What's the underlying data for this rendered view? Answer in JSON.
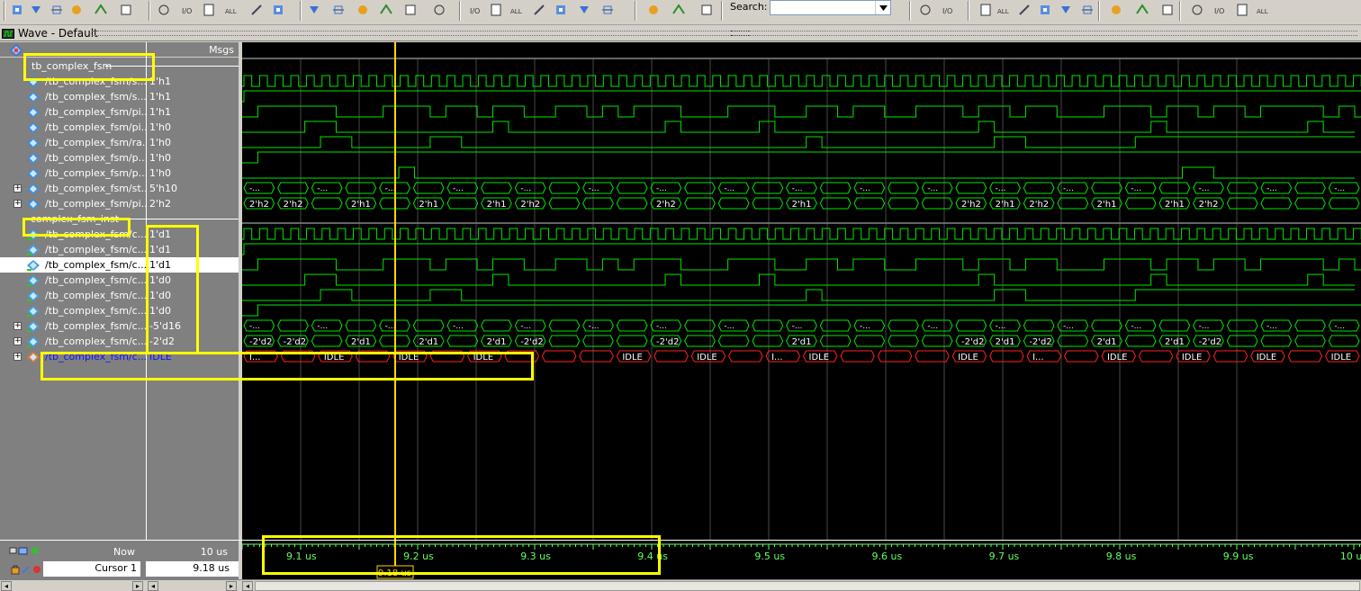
{
  "window": {
    "title": "Wave - Default"
  },
  "toolbar": {
    "search_label": "Search:",
    "search_value": "",
    "icons": [
      "add-wave-icon",
      "add-wave-dropdown-icon",
      "insert-divider-icon",
      "insert-breakpoint-icon",
      "dataflow-icon",
      "list-icon",
      "wildcard-icon",
      "log-icon",
      "all-icon",
      "write-icon",
      "select-mode-icon",
      "zoom-mode-icon",
      "pan-mode-icon",
      "edit-mode-icon",
      "stretch-edge-icon",
      "probe-icon",
      "find-previous-edge-icon",
      "find-next-edge-icon",
      "find-previous-fall-icon",
      "find-next-fall-icon",
      "find-previous-rise-icon",
      "find-next-rise-icon",
      "step-into-icon",
      "step-over-icon",
      "step-out-icon",
      "search-icon",
      "find-next-icon",
      "find-previous-icon",
      "zoom-in-icon",
      "zoom-out-icon",
      "zoom-full-icon",
      "zoom-cursor-icon",
      "zoom-range-icon",
      "insert-cursor-icon",
      "wave-format-icon",
      "bar-format-icon",
      "box-format-icon",
      "leaf-icon",
      "literal-icon",
      "event-icon"
    ]
  },
  "pane_header": {
    "msgs": "Msgs"
  },
  "groups": [
    {
      "label": "tb_complex_fsm"
    },
    {
      "label": "complex_fsm_inst"
    }
  ],
  "signals": [
    {
      "name": "/tb_complex_fsm/s...",
      "value": "1'h1",
      "kind": "in",
      "bus": false,
      "wave": "clk"
    },
    {
      "name": "/tb_complex_fsm/s...",
      "value": "1'h1",
      "kind": "in",
      "bus": false,
      "wave": "high"
    },
    {
      "name": "/tb_complex_fsm/pi...",
      "value": "1'h1",
      "kind": "in",
      "bus": false,
      "wave": "w3"
    },
    {
      "name": "/tb_complex_fsm/pi...",
      "value": "1'h0",
      "kind": "in",
      "bus": false,
      "wave": "w4"
    },
    {
      "name": "/tb_complex_fsm/ra...",
      "value": "1'h0",
      "kind": "in",
      "bus": false,
      "wave": "w5"
    },
    {
      "name": "/tb_complex_fsm/p...",
      "value": "1'h0",
      "kind": "in",
      "bus": false,
      "wave": "w6"
    },
    {
      "name": "/tb_complex_fsm/p...",
      "value": "1'h0",
      "kind": "in",
      "bus": false,
      "wave": "w7"
    },
    {
      "name": "/tb_complex_fsm/st...",
      "value": "5'h10",
      "kind": "in",
      "bus": true,
      "wave": "bus"
    },
    {
      "name": "/tb_complex_fsm/pi...",
      "value": "2'h2",
      "kind": "in",
      "bus": true,
      "wave": "bus2"
    },
    {
      "name": "/tb_complex_fsm/c...",
      "value": "1'd1",
      "kind": "port",
      "bus": false,
      "wave": "clk"
    },
    {
      "name": "/tb_complex_fsm/c...",
      "value": "1'd1",
      "kind": "port",
      "bus": false,
      "wave": "high"
    },
    {
      "name": "/tb_complex_fsm/c...",
      "value": "1'd1",
      "kind": "port",
      "bus": false,
      "wave": "w3",
      "selected": true
    },
    {
      "name": "/tb_complex_fsm/c...",
      "value": "1'd0",
      "kind": "port",
      "bus": false,
      "wave": "w4"
    },
    {
      "name": "/tb_complex_fsm/c...",
      "value": "1'd0",
      "kind": "port",
      "bus": false,
      "wave": "w5"
    },
    {
      "name": "/tb_complex_fsm/c...",
      "value": "1'd0",
      "kind": "port",
      "bus": false,
      "wave": "w6"
    },
    {
      "name": "/tb_complex_fsm/c...",
      "value": "-5'd16",
      "kind": "port",
      "bus": true,
      "wave": "bus"
    },
    {
      "name": "/tb_complex_fsm/c...",
      "value": "-2'd2",
      "kind": "port",
      "bus": true,
      "wave": "bus3"
    },
    {
      "name": "/tb_complex_fsm/c...",
      "value": "IDLE",
      "kind": "state",
      "bus": true,
      "wave": "state",
      "highlight": true
    }
  ],
  "bus_labels": {
    "bus": "-...",
    "bus2": [
      [
        "2'h2",
        0
      ],
      [
        "2'h2",
        1
      ],
      [
        "2'h1",
        3
      ],
      [
        "2'h1",
        5
      ],
      [
        "2'h1",
        7
      ],
      [
        "2'h2",
        8
      ],
      [
        "2'h2",
        12
      ],
      [
        "2'h1",
        16
      ],
      [
        "2'h2",
        21
      ],
      [
        "2'h1",
        22
      ],
      [
        "2'h2",
        23
      ],
      [
        "2'h1",
        25
      ],
      [
        "2'h1",
        27
      ],
      [
        "2'h2",
        28
      ]
    ],
    "bus3": [
      [
        "-2'd2",
        0
      ],
      [
        "-2'd2",
        1
      ],
      [
        "2'd1",
        3
      ],
      [
        "2'd1",
        5
      ],
      [
        "2'd1",
        7
      ],
      [
        "-2'd2",
        8
      ],
      [
        "-2'd2",
        12
      ],
      [
        "2'd1",
        16
      ],
      [
        "-2'd2",
        21
      ],
      [
        "2'd1",
        22
      ],
      [
        "-2'd2",
        23
      ],
      [
        "2'd1",
        25
      ],
      [
        "2'd1",
        27
      ],
      [
        "-2'd2",
        28
      ]
    ],
    "state": [
      [
        "I...",
        0
      ],
      [
        "IDLE",
        2
      ],
      [
        "IDLE",
        4
      ],
      [
        "IDLE",
        6
      ],
      [
        "IDLE",
        10
      ],
      [
        "IDLE",
        12
      ],
      [
        "I...",
        14
      ],
      [
        "IDLE",
        15
      ],
      [
        "IDLE",
        19
      ],
      [
        "I...",
        21
      ],
      [
        "IDLE",
        23
      ],
      [
        "IDLE",
        25
      ],
      [
        "IDLE",
        27
      ],
      [
        "IDLE",
        29
      ]
    ]
  },
  "status": {
    "now_label": "Now",
    "now_value": "10 us",
    "cursor_label": "Cursor 1",
    "cursor_value": "9.18 us",
    "cursor_flag": "9.18 us"
  },
  "timeline": {
    "ticks": [
      "9.1 us",
      "9.2 us",
      "9.3 us",
      "9.4 us",
      "9.5 us",
      "9.6 us",
      "9.7 us",
      "9.8 us",
      "9.9 us",
      "10 us"
    ],
    "start_us": 9.0,
    "end_us": 10.0,
    "cursor_us": 9.18
  },
  "colors": {
    "wave": "#00e600",
    "state_wave": "#ff2020",
    "cursor": "#ffd700",
    "annotation": "#ffff00",
    "grid": "#7a7a7a",
    "timeline": "#66ff66"
  }
}
